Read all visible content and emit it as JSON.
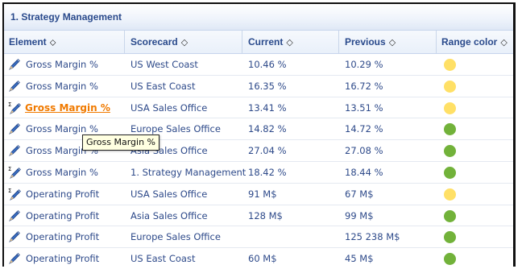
{
  "section_title": "1. Strategy Management",
  "columns": {
    "element": "Element",
    "scorecard": "Scorecard",
    "current": "Current",
    "previous": "Previous",
    "range_color": "Range color"
  },
  "sort_icons": {
    "sorted_asc": "⬦",
    "unsorted": "◇"
  },
  "colors": {
    "yellow": "#ffe066",
    "green": "#72b23a",
    "highlight": "#f07a00"
  },
  "rows": [
    {
      "element": "Gross Margin %",
      "icon": "kpi-pen-icon",
      "scorecard": "US West Coast",
      "current": "10.46 %",
      "previous": "10.29 %",
      "range": "yellow"
    },
    {
      "element": "Gross Margin %",
      "icon": "kpi-pen-icon",
      "scorecard": "US East Coast",
      "current": "16.35 %",
      "previous": "16.72 %",
      "range": "yellow"
    },
    {
      "element": "Gross Margin %",
      "icon": "kpi-sigma-pen-icon",
      "scorecard": "USA Sales Office",
      "current": "13.41 %",
      "previous": "13.51 %",
      "range": "yellow",
      "highlight": true
    },
    {
      "element": "Gross Margin %",
      "icon": "kpi-pen-icon",
      "scorecard": "Europe Sales Office",
      "current": "14.82 %",
      "previous": "14.72 %",
      "range": "green"
    },
    {
      "element": "Gross Margin %",
      "icon": "kpi-pen-icon",
      "scorecard": "Asia Sales Office",
      "current": "27.04 %",
      "previous": "27.08 %",
      "range": "green"
    },
    {
      "element": "Gross Margin %",
      "icon": "kpi-sigma-pen-icon",
      "scorecard": "1. Strategy Management",
      "current": "18.42 %",
      "previous": "18.44 %",
      "range": "green"
    },
    {
      "element": "Operating Profit",
      "icon": "kpi-sigma-pen-icon",
      "scorecard": "USA Sales Office",
      "current": "91 M$",
      "previous": "67 M$",
      "range": "yellow"
    },
    {
      "element": "Operating Profit",
      "icon": "kpi-pen-icon",
      "scorecard": "Asia Sales Office",
      "current": "128 M$",
      "previous": "99 M$",
      "range": "green"
    },
    {
      "element": "Operating Profit",
      "icon": "kpi-pen-icon",
      "scorecard": "Europe Sales Office",
      "current": "",
      "previous": "125 238 M$",
      "range": "green"
    },
    {
      "element": "Operating Profit",
      "icon": "kpi-pen-icon",
      "scorecard": "US East Coast",
      "current": "60 M$",
      "previous": "45 M$",
      "range": "green"
    }
  ],
  "tooltip": {
    "text": "Gross Margin %"
  }
}
